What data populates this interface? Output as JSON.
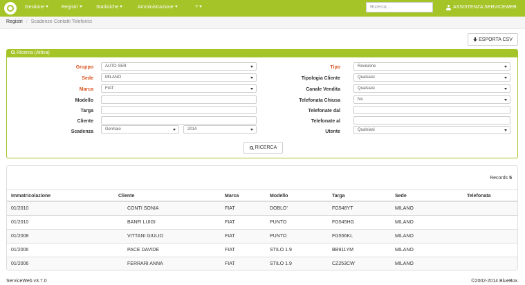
{
  "navbar": {
    "menu": [
      {
        "label": "Gestione"
      },
      {
        "label": "Registri"
      },
      {
        "label": "Statistiche"
      },
      {
        "label": "Amministrazione"
      },
      {
        "label": "?"
      }
    ],
    "search_placeholder": "Ricerca ...",
    "user": "ASSISTENZA SERVICEWEB"
  },
  "breadcrumb": {
    "parent": "Registri",
    "separator": "/",
    "current": "Scadenze Contatti Telefonici"
  },
  "export_button": "ESPORTA CSV",
  "search": {
    "title": "Ricerca (Attiva)",
    "left": {
      "gruppo": {
        "label": "Gruppo",
        "value": "AUTO SER"
      },
      "sede": {
        "label": "Sede",
        "value": "MILANO"
      },
      "marca": {
        "label": "Marca",
        "value": "FIAT"
      },
      "modello": {
        "label": "Modello",
        "value": ""
      },
      "targa": {
        "label": "Targa",
        "value": ""
      },
      "cliente": {
        "label": "Cliente",
        "value": ""
      },
      "scadenza": {
        "label": "Scadenza",
        "month": "Gennaio",
        "year": "2014"
      }
    },
    "right": {
      "tipo": {
        "label": "Tipo",
        "value": "Revisione"
      },
      "tipologia": {
        "label": "Tipologia Cliente",
        "value": "Qualsiasi"
      },
      "canale": {
        "label": "Canale Vendita",
        "value": "Qualsiasi"
      },
      "chiusa": {
        "label": "Telefonata Chiusa",
        "value": "No"
      },
      "dal": {
        "label": "Telefonate dal",
        "value": ""
      },
      "al": {
        "label": "Telefonate al",
        "value": ""
      },
      "utente": {
        "label": "Utente",
        "value": "Qualsiasi"
      }
    },
    "button": "RICERCA"
  },
  "results": {
    "records_label": "Records",
    "records_count": "5",
    "columns": [
      "Immatricolazione",
      "Cliente",
      "Marca",
      "Modello",
      "Targa",
      "Sede",
      "Telefonata"
    ],
    "rows": [
      [
        "01/2010",
        "CONTI SONIA",
        "FIAT",
        "DOBLO'",
        "FG548YT",
        "MILANO",
        ""
      ],
      [
        "01/2010",
        "BANFI LUIGI",
        "FIAT",
        "PUNTO",
        "FG545HG",
        "MILANO",
        ""
      ],
      [
        "01/2008",
        "VITTANI GIULIO",
        "FIAT",
        "PUNTO",
        "FG556KL",
        "MILANO",
        ""
      ],
      [
        "01/2006",
        "PACE DAVIDE",
        "FIAT",
        "STILO 1.9",
        "BB911YM",
        "MILANO",
        ""
      ],
      [
        "01/2006",
        "FERRARI ANNA",
        "FIAT",
        "STILO 1.9",
        "CZ253CW",
        "MILANO",
        ""
      ]
    ]
  },
  "footer": {
    "version": "ServiceWeb v3.7.0",
    "copyright": "©2002-2014 BlueBox."
  },
  "colors": {
    "brand_green": "#a5c428",
    "required_label": "#d9531e"
  }
}
